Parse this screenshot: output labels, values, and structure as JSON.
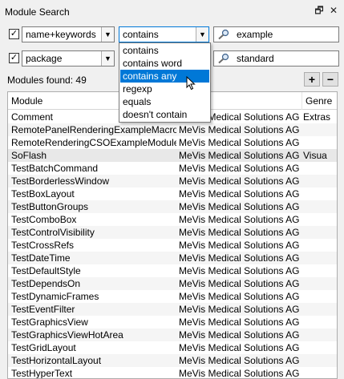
{
  "panel": {
    "title": "Module Search",
    "float_icon": "float-icon",
    "close_icon": "close-icon",
    "close_glyph": "✕",
    "float_glyph": "🗗"
  },
  "filter1": {
    "checked_glyph": "✓",
    "field": "name+keywords",
    "mode": "contains",
    "search_value": "example"
  },
  "filter2": {
    "checked_glyph": "✓",
    "field": "package",
    "search_value": "standard"
  },
  "mode_dropdown": {
    "options": [
      "contains",
      "contains word",
      "contains any",
      "regexp",
      "equals",
      "doesn't contain"
    ],
    "highlighted": "contains any"
  },
  "summary": {
    "found_text": "Modules found: 49",
    "add_label": "+",
    "remove_label": "−"
  },
  "table": {
    "columns": [
      "Module",
      "",
      "Genre"
    ],
    "rows": [
      [
        "Comment",
        "MeVis Medical Solutions AG",
        "Extras"
      ],
      [
        "RemotePanelRenderingExampleMacro",
        "MeVis Medical Solutions AG",
        ""
      ],
      [
        "RemoteRenderingCSOExampleModule",
        "MeVis Medical Solutions AG",
        ""
      ],
      [
        "SoFlash",
        "MeVis Medical Solutions AG",
        "Visua"
      ],
      [
        "TestBatchCommand",
        "MeVis Medical Solutions AG",
        ""
      ],
      [
        "TestBorderlessWindow",
        "MeVis Medical Solutions AG",
        ""
      ],
      [
        "TestBoxLayout",
        "MeVis Medical Solutions AG",
        ""
      ],
      [
        "TestButtonGroups",
        "MeVis Medical Solutions AG",
        ""
      ],
      [
        "TestComboBox",
        "MeVis Medical Solutions AG",
        ""
      ],
      [
        "TestControlVisibility",
        "MeVis Medical Solutions AG",
        ""
      ],
      [
        "TestCrossRefs",
        "MeVis Medical Solutions AG",
        ""
      ],
      [
        "TestDateTime",
        "MeVis Medical Solutions AG",
        ""
      ],
      [
        "TestDefaultStyle",
        "MeVis Medical Solutions AG",
        ""
      ],
      [
        "TestDependsOn",
        "MeVis Medical Solutions AG",
        ""
      ],
      [
        "TestDynamicFrames",
        "MeVis Medical Solutions AG",
        ""
      ],
      [
        "TestEventFilter",
        "MeVis Medical Solutions AG",
        ""
      ],
      [
        "TestGraphicsView",
        "MeVis Medical Solutions AG",
        ""
      ],
      [
        "TestGraphicsViewHotArea",
        "MeVis Medical Solutions AG",
        ""
      ],
      [
        "TestGridLayout",
        "MeVis Medical Solutions AG",
        ""
      ],
      [
        "TestHorizontalLayout",
        "MeVis Medical Solutions AG",
        ""
      ],
      [
        "TestHyperText",
        "MeVis Medical Solutions AG",
        ""
      ]
    ]
  },
  "colors": {
    "selection": "#0078d7",
    "alt_row": "#f5f5f5",
    "background": "#f0f0f0"
  }
}
